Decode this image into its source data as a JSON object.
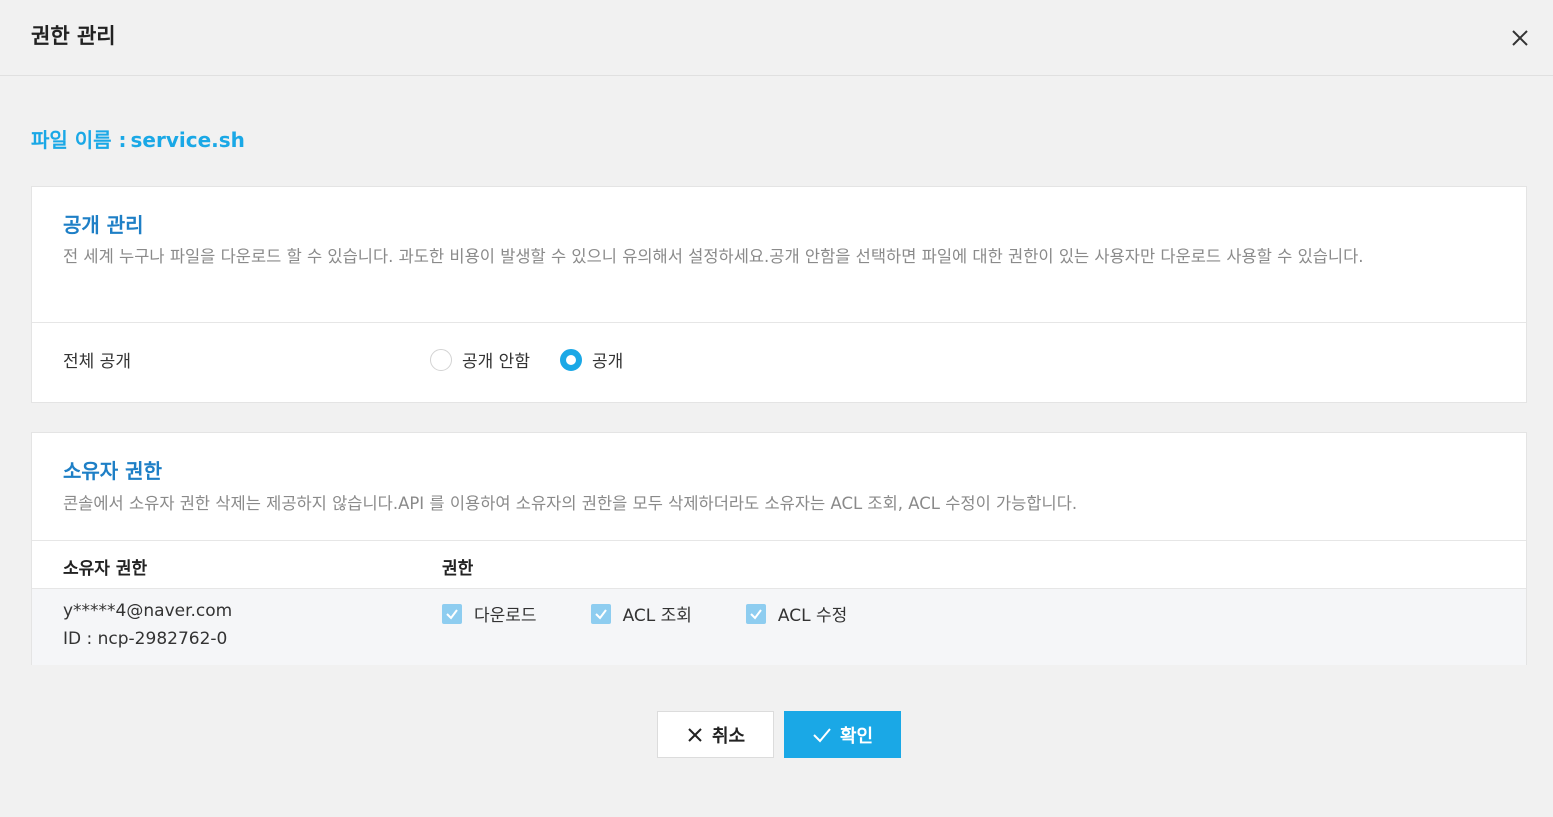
{
  "dialog": {
    "title": "권한 관리"
  },
  "file": {
    "label": "파일 이름 :",
    "name": "service.sh"
  },
  "public_section": {
    "title": "공개 관리",
    "description": "전 세계 누구나 파일을 다운로드 할 수 있습니다. 과도한 비용이 발생할 수 있으니 유의해서 설정하세요.공개 안함을 선택하면 파일에 대한 권한이 있는 사용자만 다운로드 사용할 수 있습니다.",
    "row_label": "전체 공개",
    "options": [
      {
        "label": "공개 안함",
        "checked": false
      },
      {
        "label": "공개",
        "checked": true
      }
    ]
  },
  "owner_section": {
    "title": "소유자 권한",
    "description": "콘솔에서 소유자 권한 삭제는 제공하지 않습니다.API 를 이용하여 소유자의 권한을 모두 삭제하더라도 소유자는 ACL 조회, ACL 수정이 가능합니다.",
    "columns": [
      "소유자 권한",
      "권한"
    ],
    "owner": {
      "email": "y*****4@naver.com",
      "id": "ID : ncp-2982762-0"
    },
    "permissions": [
      {
        "label": "다운로드",
        "checked": true
      },
      {
        "label": "ACL 조회",
        "checked": true
      },
      {
        "label": "ACL 수정",
        "checked": true
      }
    ]
  },
  "buttons": {
    "cancel": "취소",
    "ok": "확인"
  },
  "colors": {
    "accent": "#1aa8e6",
    "section_title": "#1e7fc6",
    "checkbox": "#8ecdf0"
  }
}
